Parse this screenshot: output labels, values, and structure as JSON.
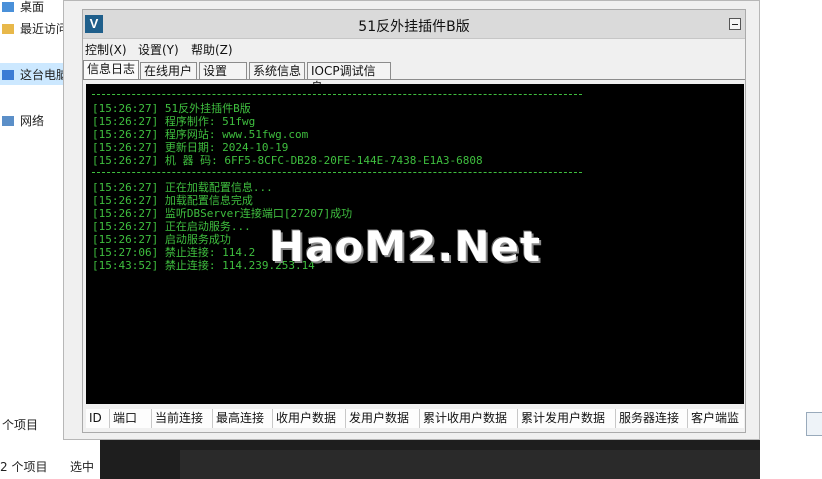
{
  "background": {
    "sidebar_items": [
      {
        "label": "桌面",
        "icon": "desktop-icon"
      },
      {
        "label": "最近访问",
        "icon": "recent-icon"
      },
      {
        "label": "这台电脑",
        "icon": "computer-icon"
      },
      {
        "label": "网络",
        "icon": "network-icon"
      }
    ],
    "status_items_count": "个项目",
    "status_bottom_count": "2 个项目",
    "status_bottom_selected": "选中"
  },
  "window": {
    "icon_letter": "V",
    "title": "51反外挂插件B版",
    "menu": [
      "控制(X)",
      "设置(Y)",
      "帮助(Z)"
    ],
    "tabs": [
      "信息日志",
      "在线用户",
      "设置",
      "系统信息",
      "IOCP调试信息"
    ],
    "active_tab_index": 0,
    "log_separator": "————————————————————————————————————",
    "log_group1": [
      "[15:26:27] 51反外挂插件B版",
      "[15:26:27] 程序制作: 51fwg",
      "[15:26:27] 程序网站: www.51fwg.com",
      "[15:26:27] 更新日期: 2024-10-19",
      "[15:26:27] 机 器 码: 6FF5-8CFC-DB28-20FE-144E-7438-E1A3-6808"
    ],
    "log_group2": [
      "[15:26:27] 正在加载配置信息...",
      "[15:26:27] 加载配置信息完成",
      "[15:26:27] 监听DBServer连接端口[27207]成功",
      "[15:26:27] 正在启动服务...",
      "[15:26:27] 启动服务成功",
      "[15:27:06] 禁止连接: 114.2",
      "[15:43:52] 禁止连接: 114.239.253.14"
    ],
    "watermark": "HaoM2.Net",
    "columns": [
      "ID",
      "端口",
      "当前连接",
      "最高连接",
      "收用户数据",
      "发用户数据",
      "累计收用户数据",
      "累计发用户数据",
      "服务器连接",
      "客户端监"
    ]
  },
  "colors": {
    "console_bg": "#000000",
    "console_text": "#3fbf3f",
    "app_icon_bg": "#1f5f8b"
  }
}
